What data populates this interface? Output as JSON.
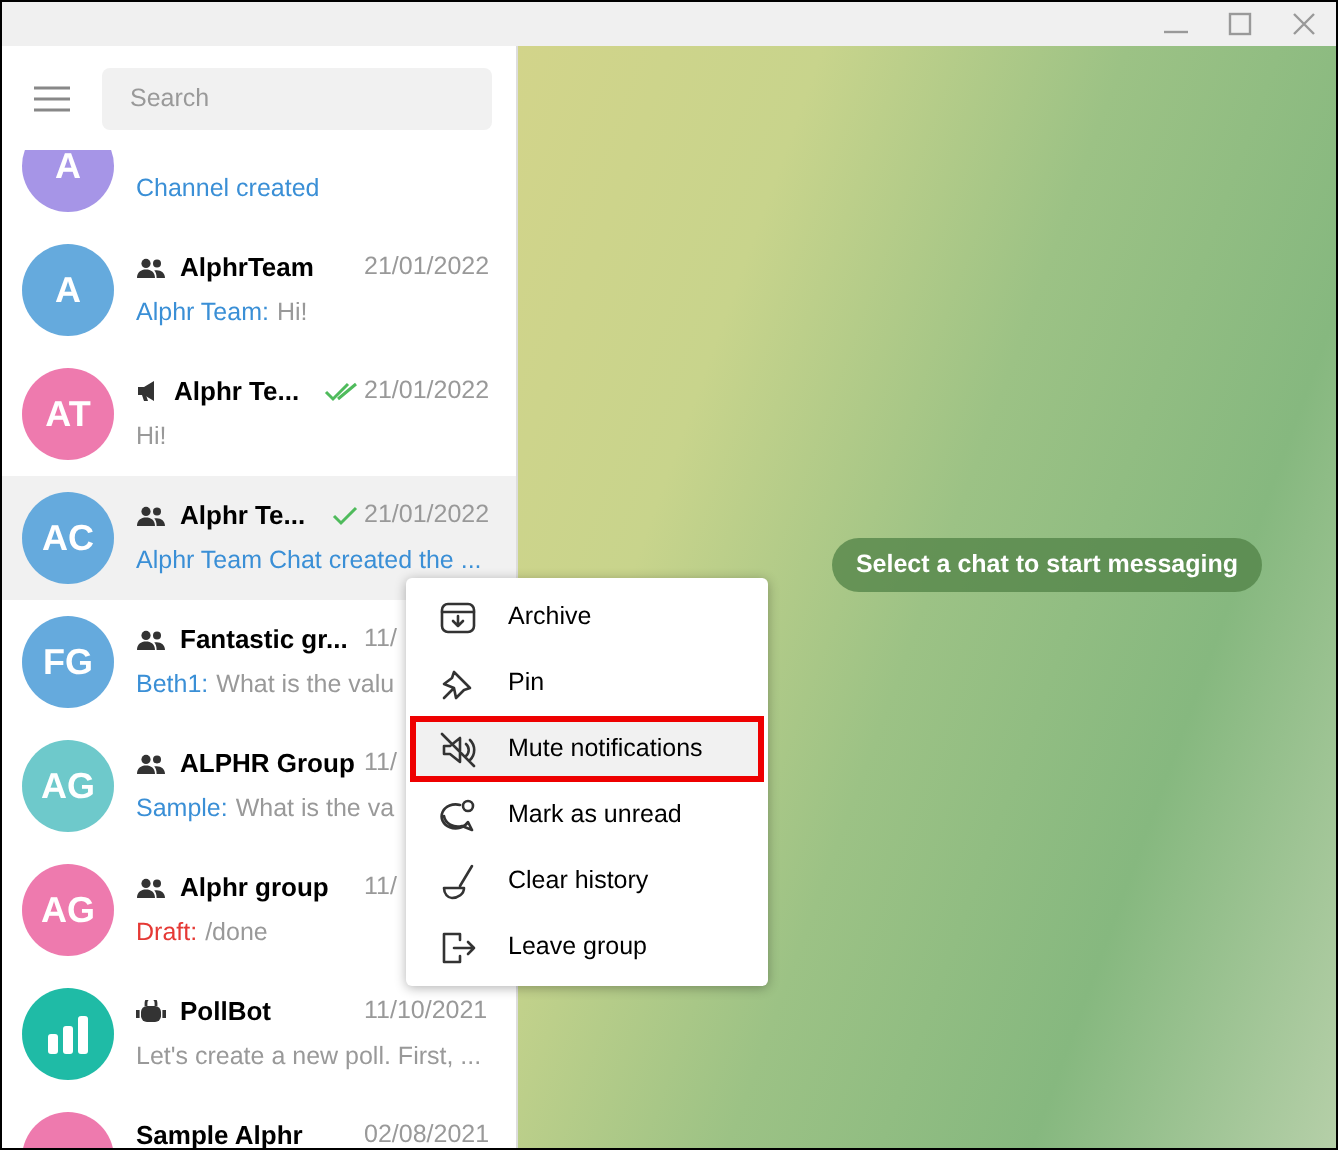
{
  "search": {
    "placeholder": "Search"
  },
  "chats": [
    {
      "avatar": "A",
      "color": "#a695e7",
      "kind": "none",
      "sent": false,
      "read": false,
      "preview": [
        {
          "kind": "service",
          "text": "Channel created"
        }
      ],
      "selected": false
    },
    {
      "avatar": "A",
      "color": "#65aadd",
      "kind": "group",
      "name": "AlphrTeam",
      "date": "21/01/2022",
      "sent": false,
      "read": false,
      "preview": [
        {
          "kind": "sender",
          "text": "Alphr Team:"
        },
        {
          "kind": "text",
          "text": "Hi!"
        }
      ],
      "selected": false
    },
    {
      "avatar": "AT",
      "color": "#ee7aae",
      "kind": "channel",
      "name": "Alphr Te...",
      "date": "21/01/2022",
      "sent": true,
      "read": true,
      "preview": [
        {
          "kind": "text",
          "text": "Hi!"
        }
      ],
      "selected": false
    },
    {
      "avatar": "AC",
      "color": "#65aadd",
      "kind": "group",
      "name": "Alphr Te...",
      "date": "21/01/2022",
      "sent": true,
      "read": false,
      "preview": [
        {
          "kind": "service",
          "text": "Alphr Team Chat created the ..."
        }
      ],
      "selected": true
    },
    {
      "avatar": "FG",
      "color": "#65aadd",
      "kind": "group",
      "name": "Fantastic gr...",
      "date": "11/",
      "sent": false,
      "read": false,
      "preview": [
        {
          "kind": "sender",
          "text": "Beth1:"
        },
        {
          "kind": "text",
          "text": "What is the valu"
        }
      ],
      "selected": false
    },
    {
      "avatar": "AG",
      "color": "#6ec9cb",
      "kind": "group",
      "name": "ALPHR Group",
      "date": "11/",
      "sent": false,
      "read": false,
      "preview": [
        {
          "kind": "sender",
          "text": "Sample:"
        },
        {
          "kind": "text",
          "text": "What is the va"
        }
      ],
      "selected": false
    },
    {
      "avatar": "AG",
      "color": "#ee7aae",
      "kind": "group",
      "name": "Alphr group",
      "date": "11/",
      "sent": false,
      "read": false,
      "preview": [
        {
          "kind": "draft",
          "text": "Draft:"
        },
        {
          "kind": "text",
          "text": "/done"
        }
      ],
      "selected": false
    },
    {
      "color": "#1fbba6",
      "kind": "bot",
      "name": "PollBot",
      "date": "11/10/2021",
      "sent": false,
      "read": false,
      "preview": [
        {
          "kind": "text",
          "text": "Let's create a new poll. First, ..."
        }
      ],
      "selected": false
    },
    {
      "color": "#ee7aae",
      "kind": "none",
      "name": "Sample Alphr",
      "date": "02/08/2021",
      "sent": false,
      "read": false,
      "selected": false
    }
  ],
  "empty_state": "Select a chat to start messaging",
  "context_menu": [
    {
      "label": "Archive",
      "selected": false
    },
    {
      "label": "Pin",
      "selected": false
    },
    {
      "label": "Mute notifications",
      "selected": true
    },
    {
      "label": "Mark as unread",
      "selected": false
    },
    {
      "label": "Clear history",
      "selected": false
    },
    {
      "label": "Leave group",
      "selected": false
    }
  ]
}
